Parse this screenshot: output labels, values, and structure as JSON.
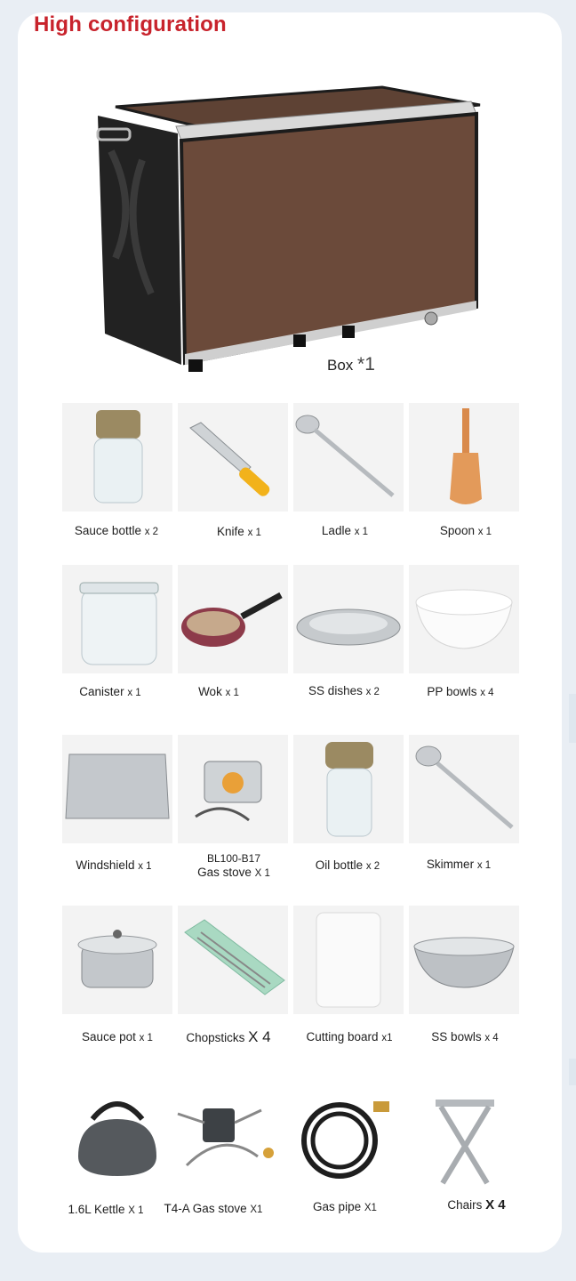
{
  "title": "High configuration",
  "box": {
    "name": "Box",
    "qty": "*1"
  },
  "items": [
    {
      "name": "Sauce bottle",
      "qty": "x 2",
      "icon": "sauce-bottle-icon"
    },
    {
      "name": "Knife",
      "qty": "x 1",
      "icon": "knife-icon"
    },
    {
      "name": "Ladle",
      "qty": "x 1",
      "icon": "ladle-icon"
    },
    {
      "name": "Spoon",
      "qty": "x 1",
      "icon": "spoon-icon"
    },
    {
      "name": "Canister",
      "qty": "x 1",
      "icon": "canister-icon"
    },
    {
      "name": "Wok",
      "qty": "x 1",
      "icon": "wok-icon"
    },
    {
      "name": "SS dishes",
      "qty": "x 2",
      "icon": "ss-dish-icon"
    },
    {
      "name": "PP bowls",
      "qty": "x 4",
      "icon": "pp-bowl-icon"
    },
    {
      "name": "Windshield",
      "qty": "x 1",
      "icon": "windshield-icon"
    },
    {
      "name": "Gas stove",
      "model": "BL100-B17",
      "qty": "X 1",
      "icon": "gas-stove-icon"
    },
    {
      "name": "Oil bottle",
      "qty": "x 2",
      "icon": "oil-bottle-icon"
    },
    {
      "name": "Skimmer",
      "qty": "x 1",
      "icon": "skimmer-icon"
    },
    {
      "name": "Sauce pot",
      "qty": "x 1",
      "icon": "sauce-pot-icon"
    },
    {
      "name": "Chopsticks",
      "qty": "X 4",
      "icon": "chopsticks-icon"
    },
    {
      "name": "Cutting board",
      "qty": "x1",
      "icon": "cutting-board-icon"
    },
    {
      "name": "SS bowls",
      "qty": "x 4",
      "icon": "ss-bowl-icon"
    },
    {
      "name": "1.6L Kettle",
      "qty": "X 1",
      "icon": "kettle-icon"
    },
    {
      "name": "T4-A Gas stove",
      "qty": "X1",
      "icon": "t4a-stove-icon"
    },
    {
      "name": "Gas pipe",
      "qty": "X1",
      "icon": "gas-pipe-icon"
    },
    {
      "name": "Chairs",
      "qty": "X 4",
      "icon": "chair-icon"
    }
  ],
  "colors": {
    "title": "#c8232c",
    "box_panel": "#6b4a3a",
    "box_frame": "#1c1c1c"
  }
}
